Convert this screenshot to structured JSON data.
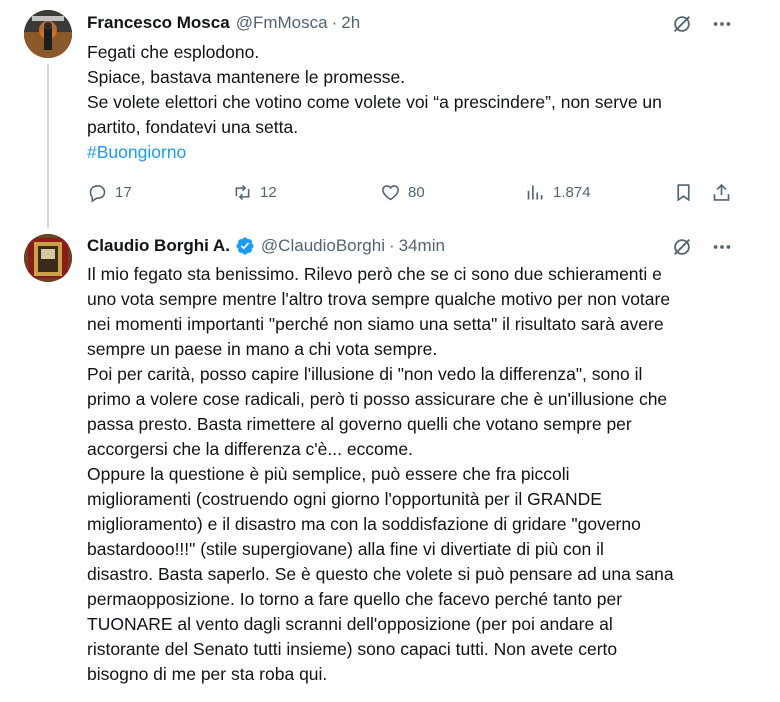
{
  "tweet1": {
    "author_name": "Francesco Mosca",
    "handle": "@FmMosca",
    "separator": "·",
    "time": "2h",
    "lines": [
      "Fegati che esplodono.",
      "Spiace, bastava mantenere le promesse.",
      "Se volete elettori che votino come volete voi “a prescindere”, non serve un",
      "partito, fondatevi una setta."
    ],
    "hashtag": "#Buongiorno",
    "stats": {
      "replies": "17",
      "reposts": "12",
      "likes": "80",
      "views": "1.874"
    }
  },
  "tweet2": {
    "author_name": "Claudio Borghi A.",
    "handle": "@ClaudioBorghi",
    "separator": "·",
    "time": "34min",
    "lines": [
      "Il mio fegato sta benissimo. Rilevo però che se ci sono due schieramenti e",
      "uno vota sempre mentre l'altro trova sempre qualche motivo per non votare",
      "nei momenti importanti \"perché non siamo una setta\" il risultato sarà avere",
      "sempre un paese in mano a chi vota sempre.",
      "Poi per carità, posso capire l'illusione di \"non vedo la differenza\", sono il",
      "primo a volere cose radicali, però ti posso assicurare che è un'illusione che",
      "passa presto. Basta rimettere al governo quelli che votano sempre per",
      "accorgersi che la differenza c'è... eccome.",
      "Oppure la questione è più semplice, può essere che fra piccoli",
      "miglioramenti (costruendo ogni giorno l'opportunità per il GRANDE",
      "miglioramento) e il disastro ma con la soddisfazione di gridare \"governo",
      "bastardooo!!!\" (stile supergiovane) alla fine vi divertiate di più con il",
      "disastro. Basta saperlo. Se è questo che volete si può pensare ad una sana",
      "permaopposizione. Io torno a fare quello che facevo perché tanto per",
      "TUONARE al vento dagli scranni dell'opposizione (per poi andare al",
      "ristorante del Senato tutti insieme) sono capaci tutti. Non avete certo",
      "bisogno di me per sta roba qui."
    ]
  },
  "icons": {
    "grok": "grok-icon",
    "more": "more-icon",
    "reply": "reply-icon",
    "repost": "repost-icon",
    "like": "like-icon",
    "views": "views-icon",
    "bookmark": "bookmark-icon",
    "share": "share-icon",
    "verified": "verified-badge-icon"
  },
  "colors": {
    "link": "#1d9bf0",
    "muted": "#536471",
    "text": "#0f1419"
  }
}
